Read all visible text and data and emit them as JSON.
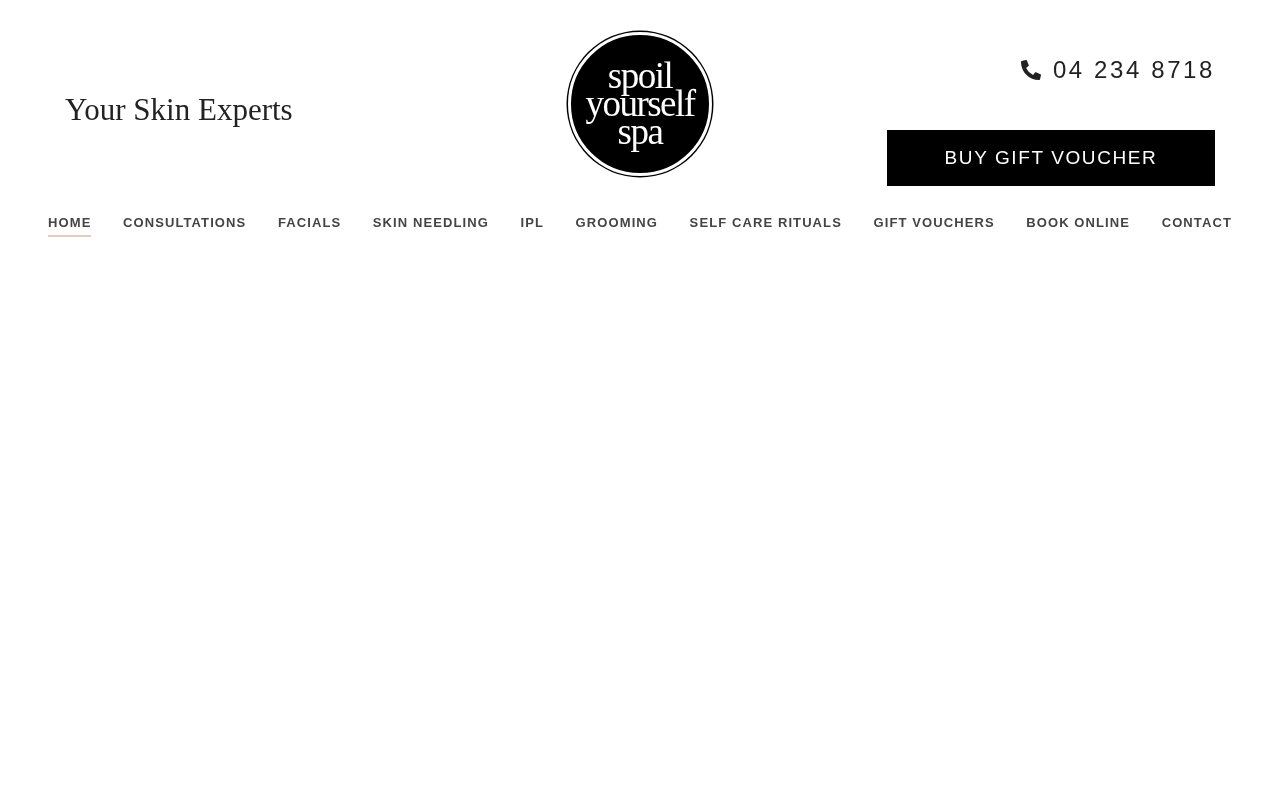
{
  "header": {
    "tagline": "Your Skin Experts",
    "logo": {
      "lines": [
        "spoil",
        "yourself",
        "spa"
      ]
    },
    "phone": "04 234 8718",
    "cta_button": "BUY GIFT VOUCHER"
  },
  "nav": [
    {
      "label": "HOME",
      "selected": true
    },
    {
      "label": "CONSULTATIONS",
      "selected": false
    },
    {
      "label": "FACIALS",
      "selected": false
    },
    {
      "label": "SKIN NEEDLING",
      "selected": false
    },
    {
      "label": "IPL",
      "selected": false
    },
    {
      "label": "GROOMING",
      "selected": false
    },
    {
      "label": "SELF CARE RITUALS",
      "selected": false
    },
    {
      "label": "GIFT VOUCHERS",
      "selected": false
    },
    {
      "label": "BOOK ONLINE",
      "selected": false
    },
    {
      "label": "CONTACT",
      "selected": false
    }
  ]
}
